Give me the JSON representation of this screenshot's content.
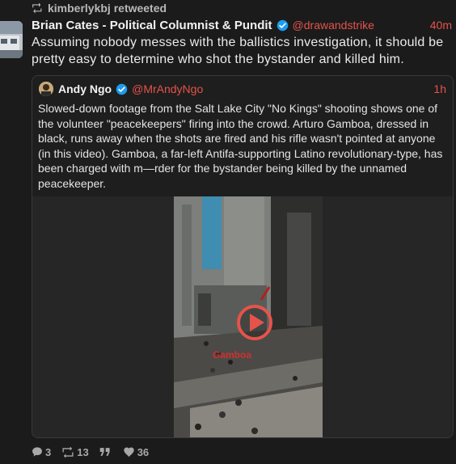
{
  "retweet": {
    "label": "kimberlykbj retweeted"
  },
  "tweet": {
    "author_name": "Brian Cates - Political Columnist & Pundit",
    "handle": "@drawandstrike",
    "time": "40m",
    "text": "Assuming nobody messes with the ballistics investigation, it should be pretty easy to determine who shot the bystander and killed him."
  },
  "quote": {
    "author_name": "Andy Ngo",
    "handle": "@MrAndyNgo",
    "time": "1h",
    "text": "Slowed-down footage from the Salt Lake City \"No Kings\" shooting shows one of the volunteer \"peacekeepers\" firing into the crowd. Arturo Gamboa, dressed in black, runs away when the shots are fired and his rifle wasn't pointed at anyone (in this video). Gamboa, a far-left Antifa-supporting Latino revolutionary-type, has been charged with m—rder for the bystander being killed by the unnamed peacekeeper.",
    "video_label": "Gamboa"
  },
  "actions": {
    "replies": "3",
    "retweets": "13",
    "quotes": "",
    "likes": "36"
  },
  "colors": {
    "accent": "#e5534b",
    "verified": "#1d9bf0",
    "background": "#1b1b1b"
  },
  "icons": [
    "retweet-icon",
    "verified-icon",
    "play-icon",
    "reply-icon",
    "quote-icon",
    "heart-icon"
  ]
}
